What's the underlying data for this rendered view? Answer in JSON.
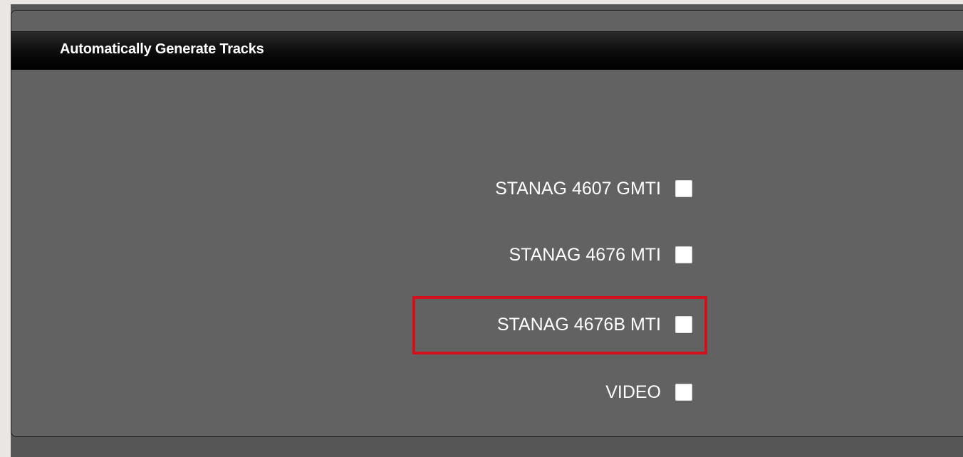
{
  "panel": {
    "title": "Automatically Generate Tracks"
  },
  "options": [
    {
      "label": "STANAG 4607 GMTI",
      "checked": false
    },
    {
      "label": "STANAG 4676 MTI",
      "checked": false
    },
    {
      "label": "STANAG 4676B MTI",
      "checked": false,
      "highlighted": true
    },
    {
      "label": "VIDEO",
      "checked": false
    }
  ],
  "colors": {
    "panel_bg": "#626262",
    "header_bg": "#000000",
    "text": "#ffffff",
    "highlight": "#d0121f"
  }
}
